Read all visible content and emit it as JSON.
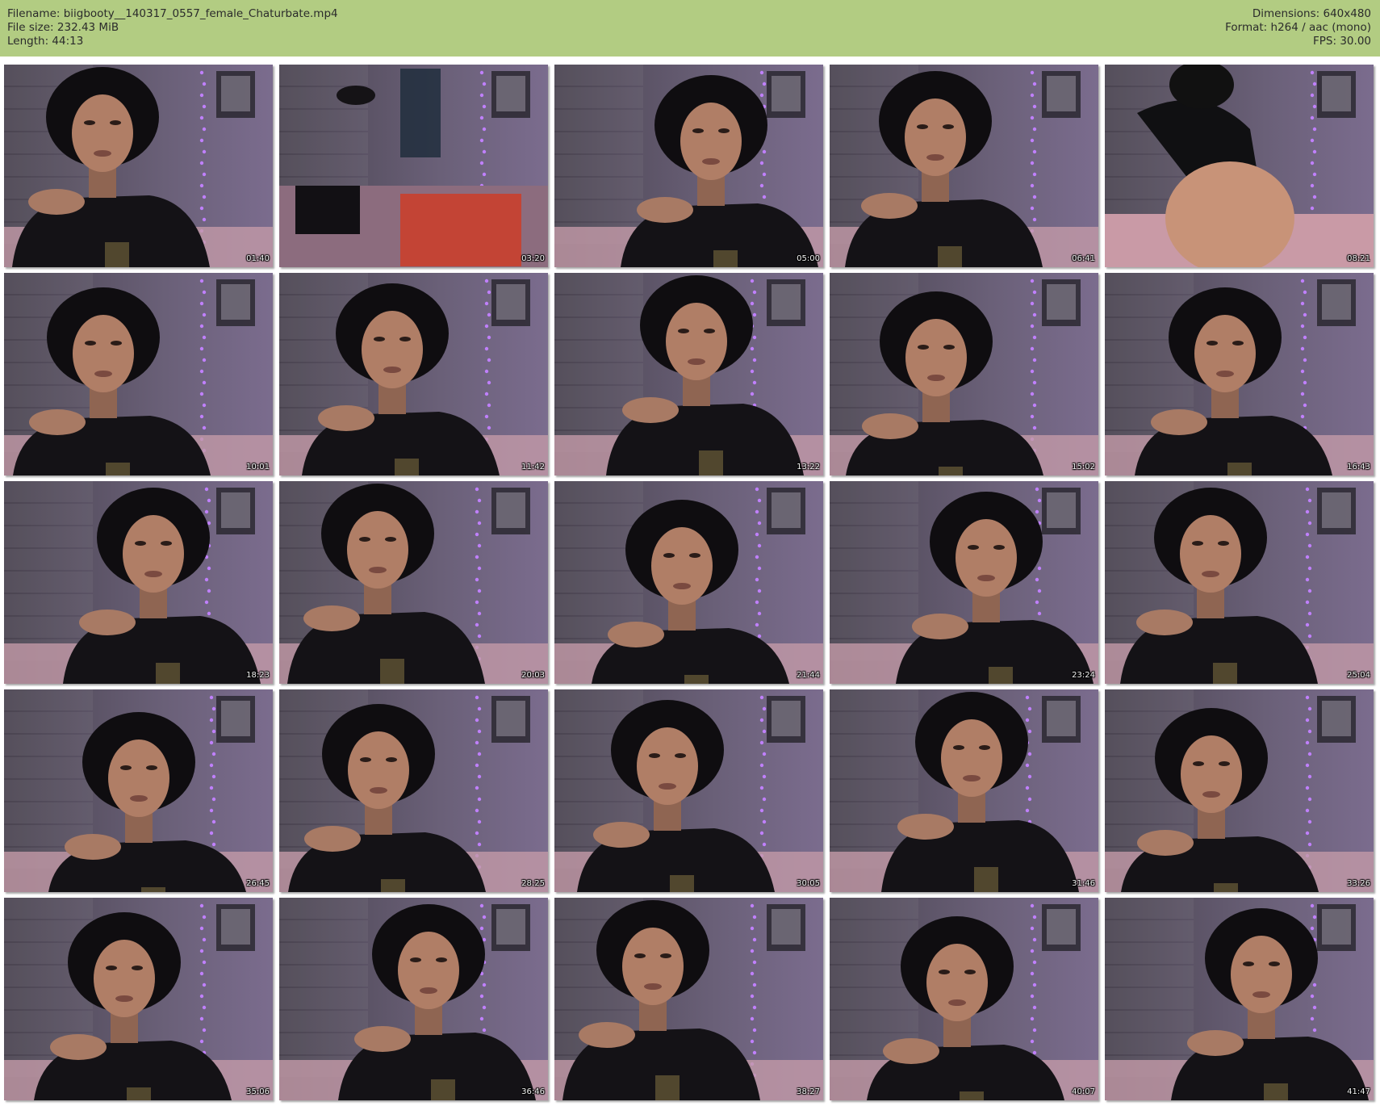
{
  "header": {
    "filename": "Filename: biigbooty__140317_0557_female_Chaturbate.mp4",
    "filesize": "File size: 232.43 MiB",
    "length": "Length: 44:13",
    "dimensions": "Dimensions: 640x480",
    "format": "Format: h264 / aac (mono)",
    "fps": "FPS: 30.00"
  },
  "colors": {
    "header_bg": "#b2cc82",
    "page_bg": "#ffffff",
    "wall": "#5e5670",
    "lights": "#b070ff"
  },
  "thumbs": [
    {
      "ts": "01:40"
    },
    {
      "ts": "03:20"
    },
    {
      "ts": "05:00"
    },
    {
      "ts": "06:41"
    },
    {
      "ts": "08:21"
    },
    {
      "ts": "10:01"
    },
    {
      "ts": "11:42"
    },
    {
      "ts": "13:22"
    },
    {
      "ts": "15:02"
    },
    {
      "ts": "16:43"
    },
    {
      "ts": "18:23"
    },
    {
      "ts": "20:03"
    },
    {
      "ts": "21:44"
    },
    {
      "ts": "23:24"
    },
    {
      "ts": "25:04"
    },
    {
      "ts": "26:45"
    },
    {
      "ts": "28:25"
    },
    {
      "ts": "30:05"
    },
    {
      "ts": "31:46"
    },
    {
      "ts": "33:26"
    },
    {
      "ts": "35:06"
    },
    {
      "ts": "36:46"
    },
    {
      "ts": "38:27"
    },
    {
      "ts": "40:07"
    },
    {
      "ts": "41:47"
    }
  ]
}
